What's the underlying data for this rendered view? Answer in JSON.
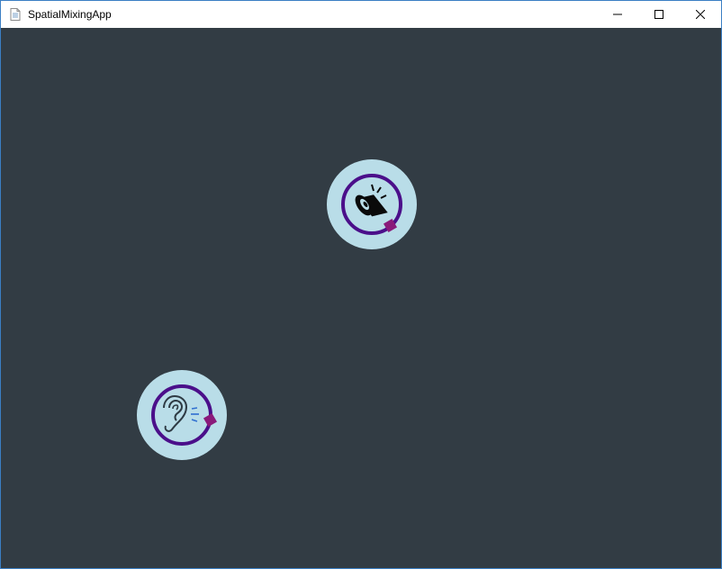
{
  "window": {
    "title": "SpatialMixingApp",
    "background_color": "#323c44",
    "controls": {
      "minimize_icon": "minimize-icon",
      "maximize_icon": "maximize-icon",
      "close_icon": "close-icon"
    }
  },
  "nodes": {
    "speaker": {
      "icon": "speaker-icon",
      "ring_color": "#4b0f8a",
      "handle_color": "#8a1a7a",
      "fill_color": "#b9dde8"
    },
    "listener": {
      "icon": "ear-icon",
      "ring_color": "#4b0f8a",
      "handle_color": "#8a1a7a",
      "fill_color": "#b9dde8"
    }
  }
}
